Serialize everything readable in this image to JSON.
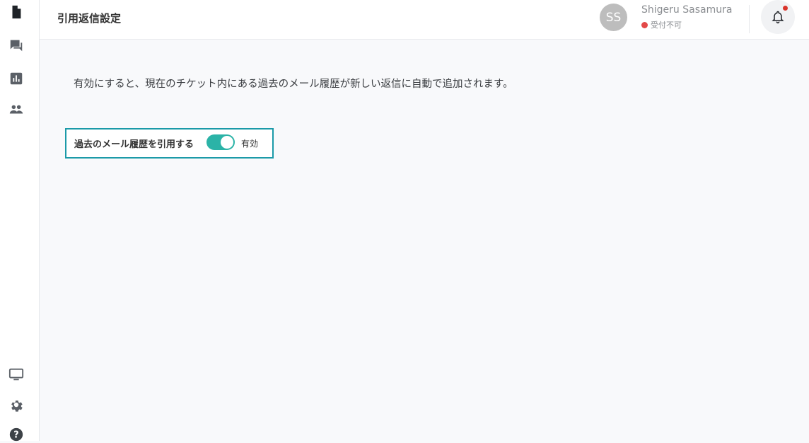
{
  "header": {
    "title": "引用返信設定",
    "user": {
      "initials": "SS",
      "name": "Shigeru Sasamura",
      "status": "受付不可",
      "status_color": "#e34948"
    },
    "notifications": {
      "icon": "bell-icon",
      "has_unread": true
    }
  },
  "sidebar": {
    "top_items": [
      {
        "icon": "document-icon"
      },
      {
        "icon": "chat-icon"
      },
      {
        "icon": "bar-chart-icon"
      },
      {
        "icon": "people-icon"
      }
    ],
    "bottom_items": [
      {
        "icon": "monitor-icon"
      },
      {
        "icon": "gear-icon"
      },
      {
        "icon": "help-icon"
      }
    ]
  },
  "main": {
    "description": "有効にすると、現在のチケット内にある過去のメール履歴が新しい返信に自動で追加されます。",
    "setting": {
      "label": "過去のメール履歴を引用する",
      "enabled": true,
      "state_label": "有効",
      "toggle_color": "#2bb3a7",
      "border_color": "#1b9aa8"
    }
  }
}
